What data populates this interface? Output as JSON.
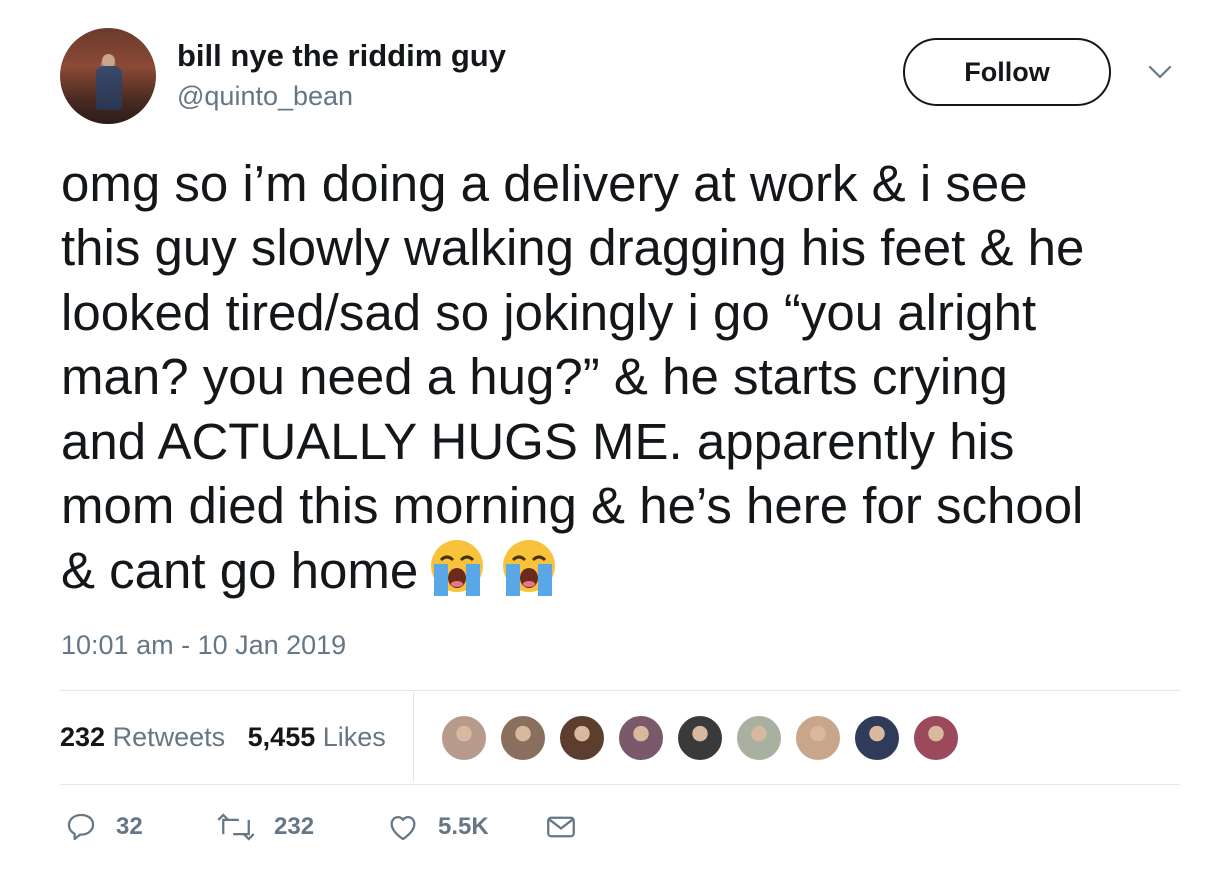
{
  "user": {
    "name": "bill nye the riddim guy",
    "handle": "@quinto_bean"
  },
  "follow_label": "Follow",
  "tweet": {
    "text": "omg so i’m doing a delivery at work & i see\nthis guy slowly walking dragging his feet & he\nlooked tired/sad so jokingly i go “you alright\nman? you need a hug?” & he starts crying\nand ACTUALLY HUGS ME. apparently his\nmom died this morning & he’s here for school\n& cant go home",
    "emoji": [
      "loudly-crying-face",
      "loudly-crying-face"
    ],
    "timestamp": "10:01 am - 10 Jan 2019"
  },
  "stats": {
    "retweets_count": "232",
    "retweets_label": "Retweets",
    "likes_count": "5,455",
    "likes_label": "Likes"
  },
  "liker_avatars": [
    {
      "color": "#b79a8c"
    },
    {
      "color": "#8a6f5f"
    },
    {
      "color": "#5c3d2e"
    },
    {
      "color": "#7a5a6a"
    },
    {
      "color": "#3a3a3a"
    },
    {
      "color": "#a8b0a0"
    },
    {
      "color": "#c9a68a"
    },
    {
      "color": "#2e3c5a"
    },
    {
      "color": "#9a4a5a"
    }
  ],
  "actions": {
    "replies": "32",
    "retweets": "232",
    "likes": "5.5K"
  },
  "colors": {
    "text": "#14171a",
    "secondary": "#657786",
    "divider": "#e1e8ed"
  }
}
